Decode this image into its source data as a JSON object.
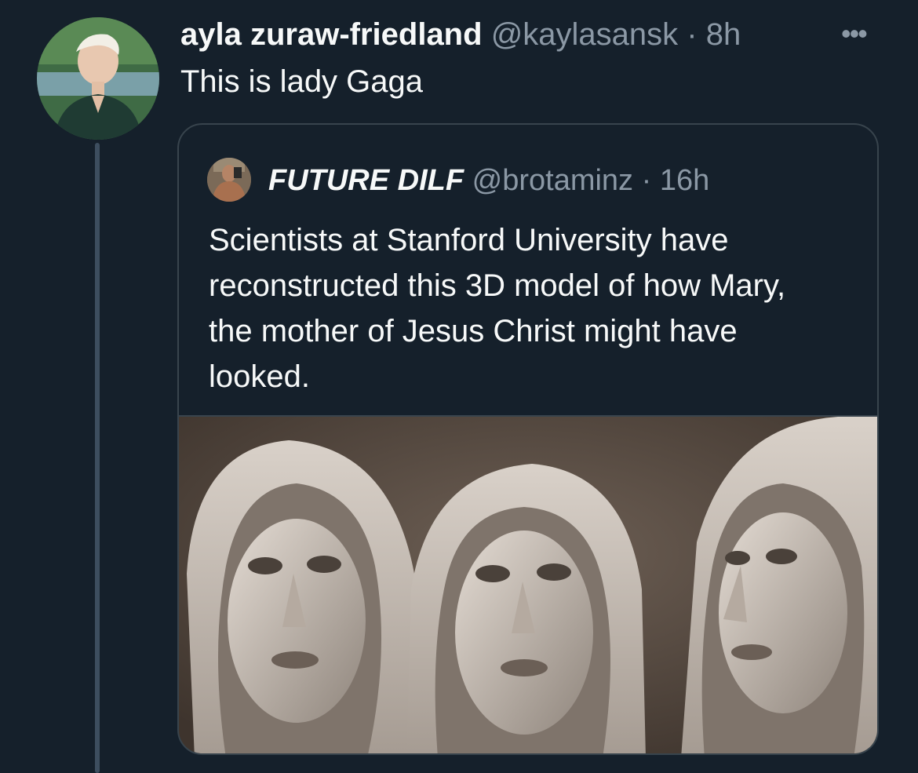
{
  "tweet": {
    "author_name": "ayla zuraw-friedland",
    "author_handle": "@kaylasansk",
    "separator": "·",
    "time": "8h",
    "more_icon": "more-horizontal-icon",
    "text": "This is lady Gaga"
  },
  "quoted_tweet": {
    "author_name": "FUTURE DILF",
    "author_handle": "@brotaminz",
    "separator": "·",
    "time": "16h",
    "text": "Scientists at Stanford University have reconstructed this 3D model of how Mary, the mother of Jesus Christ might have looked."
  },
  "colors": {
    "background": "#15202b",
    "text_primary": "#f7f9f9",
    "text_secondary": "#8b98a5",
    "border": "#38444d"
  }
}
